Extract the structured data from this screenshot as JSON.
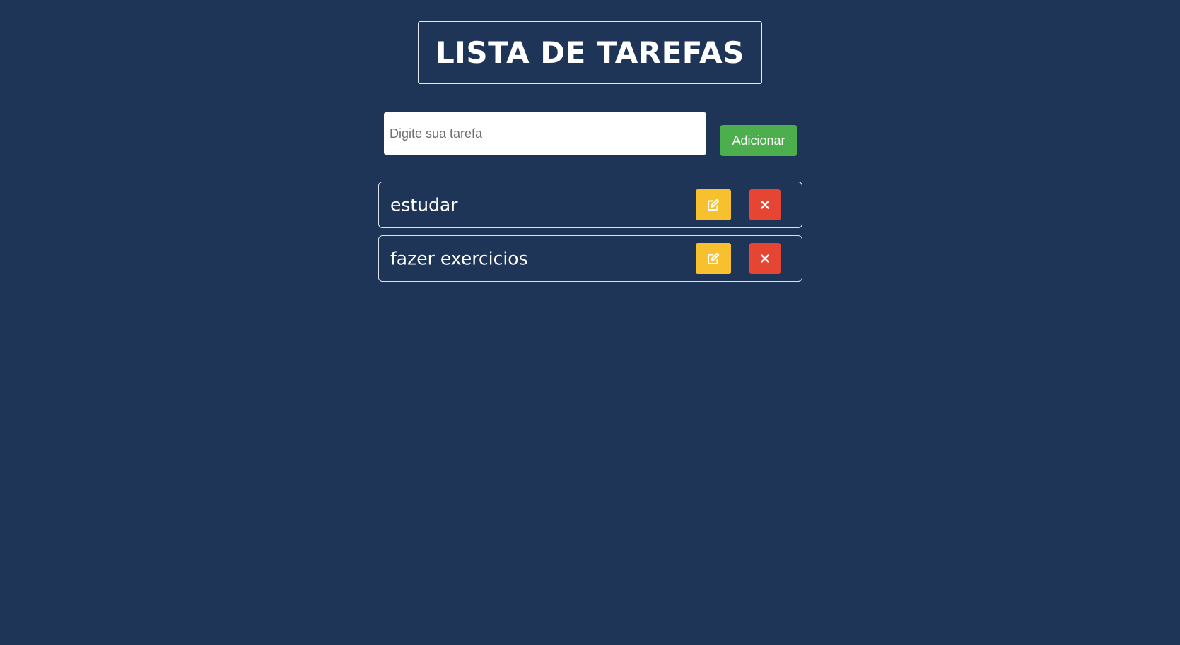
{
  "header": {
    "title": "LISTA DE TAREFAS"
  },
  "form": {
    "input_value": "",
    "input_placeholder": "Digite sua tarefa",
    "add_label": "Adicionar"
  },
  "tasks": [
    {
      "text": "estudar",
      "edit_icon": "edit-icon",
      "delete_icon": "close-icon"
    },
    {
      "text": "fazer exercicios",
      "edit_icon": "edit-icon",
      "delete_icon": "close-icon"
    }
  ],
  "colors": {
    "background": "#1e3557",
    "add_button": "#4cae4c",
    "edit_button": "#f7c02e",
    "delete_button": "#e74534",
    "border": "#dfe3ea",
    "text": "#ffffff"
  }
}
